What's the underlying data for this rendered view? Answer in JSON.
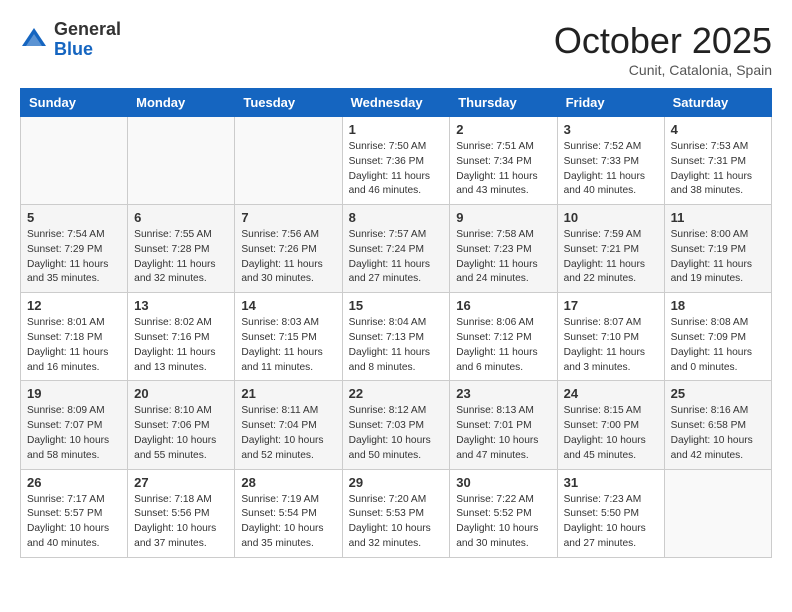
{
  "header": {
    "logo_line1": "General",
    "logo_line2": "Blue",
    "month": "October 2025",
    "location": "Cunit, Catalonia, Spain"
  },
  "weekdays": [
    "Sunday",
    "Monday",
    "Tuesday",
    "Wednesday",
    "Thursday",
    "Friday",
    "Saturday"
  ],
  "weeks": [
    [
      {
        "day": "",
        "info": ""
      },
      {
        "day": "",
        "info": ""
      },
      {
        "day": "",
        "info": ""
      },
      {
        "day": "1",
        "info": "Sunrise: 7:50 AM\nSunset: 7:36 PM\nDaylight: 11 hours\nand 46 minutes."
      },
      {
        "day": "2",
        "info": "Sunrise: 7:51 AM\nSunset: 7:34 PM\nDaylight: 11 hours\nand 43 minutes."
      },
      {
        "day": "3",
        "info": "Sunrise: 7:52 AM\nSunset: 7:33 PM\nDaylight: 11 hours\nand 40 minutes."
      },
      {
        "day": "4",
        "info": "Sunrise: 7:53 AM\nSunset: 7:31 PM\nDaylight: 11 hours\nand 38 minutes."
      }
    ],
    [
      {
        "day": "5",
        "info": "Sunrise: 7:54 AM\nSunset: 7:29 PM\nDaylight: 11 hours\nand 35 minutes."
      },
      {
        "day": "6",
        "info": "Sunrise: 7:55 AM\nSunset: 7:28 PM\nDaylight: 11 hours\nand 32 minutes."
      },
      {
        "day": "7",
        "info": "Sunrise: 7:56 AM\nSunset: 7:26 PM\nDaylight: 11 hours\nand 30 minutes."
      },
      {
        "day": "8",
        "info": "Sunrise: 7:57 AM\nSunset: 7:24 PM\nDaylight: 11 hours\nand 27 minutes."
      },
      {
        "day": "9",
        "info": "Sunrise: 7:58 AM\nSunset: 7:23 PM\nDaylight: 11 hours\nand 24 minutes."
      },
      {
        "day": "10",
        "info": "Sunrise: 7:59 AM\nSunset: 7:21 PM\nDaylight: 11 hours\nand 22 minutes."
      },
      {
        "day": "11",
        "info": "Sunrise: 8:00 AM\nSunset: 7:19 PM\nDaylight: 11 hours\nand 19 minutes."
      }
    ],
    [
      {
        "day": "12",
        "info": "Sunrise: 8:01 AM\nSunset: 7:18 PM\nDaylight: 11 hours\nand 16 minutes."
      },
      {
        "day": "13",
        "info": "Sunrise: 8:02 AM\nSunset: 7:16 PM\nDaylight: 11 hours\nand 13 minutes."
      },
      {
        "day": "14",
        "info": "Sunrise: 8:03 AM\nSunset: 7:15 PM\nDaylight: 11 hours\nand 11 minutes."
      },
      {
        "day": "15",
        "info": "Sunrise: 8:04 AM\nSunset: 7:13 PM\nDaylight: 11 hours\nand 8 minutes."
      },
      {
        "day": "16",
        "info": "Sunrise: 8:06 AM\nSunset: 7:12 PM\nDaylight: 11 hours\nand 6 minutes."
      },
      {
        "day": "17",
        "info": "Sunrise: 8:07 AM\nSunset: 7:10 PM\nDaylight: 11 hours\nand 3 minutes."
      },
      {
        "day": "18",
        "info": "Sunrise: 8:08 AM\nSunset: 7:09 PM\nDaylight: 11 hours\nand 0 minutes."
      }
    ],
    [
      {
        "day": "19",
        "info": "Sunrise: 8:09 AM\nSunset: 7:07 PM\nDaylight: 10 hours\nand 58 minutes."
      },
      {
        "day": "20",
        "info": "Sunrise: 8:10 AM\nSunset: 7:06 PM\nDaylight: 10 hours\nand 55 minutes."
      },
      {
        "day": "21",
        "info": "Sunrise: 8:11 AM\nSunset: 7:04 PM\nDaylight: 10 hours\nand 52 minutes."
      },
      {
        "day": "22",
        "info": "Sunrise: 8:12 AM\nSunset: 7:03 PM\nDaylight: 10 hours\nand 50 minutes."
      },
      {
        "day": "23",
        "info": "Sunrise: 8:13 AM\nSunset: 7:01 PM\nDaylight: 10 hours\nand 47 minutes."
      },
      {
        "day": "24",
        "info": "Sunrise: 8:15 AM\nSunset: 7:00 PM\nDaylight: 10 hours\nand 45 minutes."
      },
      {
        "day": "25",
        "info": "Sunrise: 8:16 AM\nSunset: 6:58 PM\nDaylight: 10 hours\nand 42 minutes."
      }
    ],
    [
      {
        "day": "26",
        "info": "Sunrise: 7:17 AM\nSunset: 5:57 PM\nDaylight: 10 hours\nand 40 minutes."
      },
      {
        "day": "27",
        "info": "Sunrise: 7:18 AM\nSunset: 5:56 PM\nDaylight: 10 hours\nand 37 minutes."
      },
      {
        "day": "28",
        "info": "Sunrise: 7:19 AM\nSunset: 5:54 PM\nDaylight: 10 hours\nand 35 minutes."
      },
      {
        "day": "29",
        "info": "Sunrise: 7:20 AM\nSunset: 5:53 PM\nDaylight: 10 hours\nand 32 minutes."
      },
      {
        "day": "30",
        "info": "Sunrise: 7:22 AM\nSunset: 5:52 PM\nDaylight: 10 hours\nand 30 minutes."
      },
      {
        "day": "31",
        "info": "Sunrise: 7:23 AM\nSunset: 5:50 PM\nDaylight: 10 hours\nand 27 minutes."
      },
      {
        "day": "",
        "info": ""
      }
    ]
  ]
}
